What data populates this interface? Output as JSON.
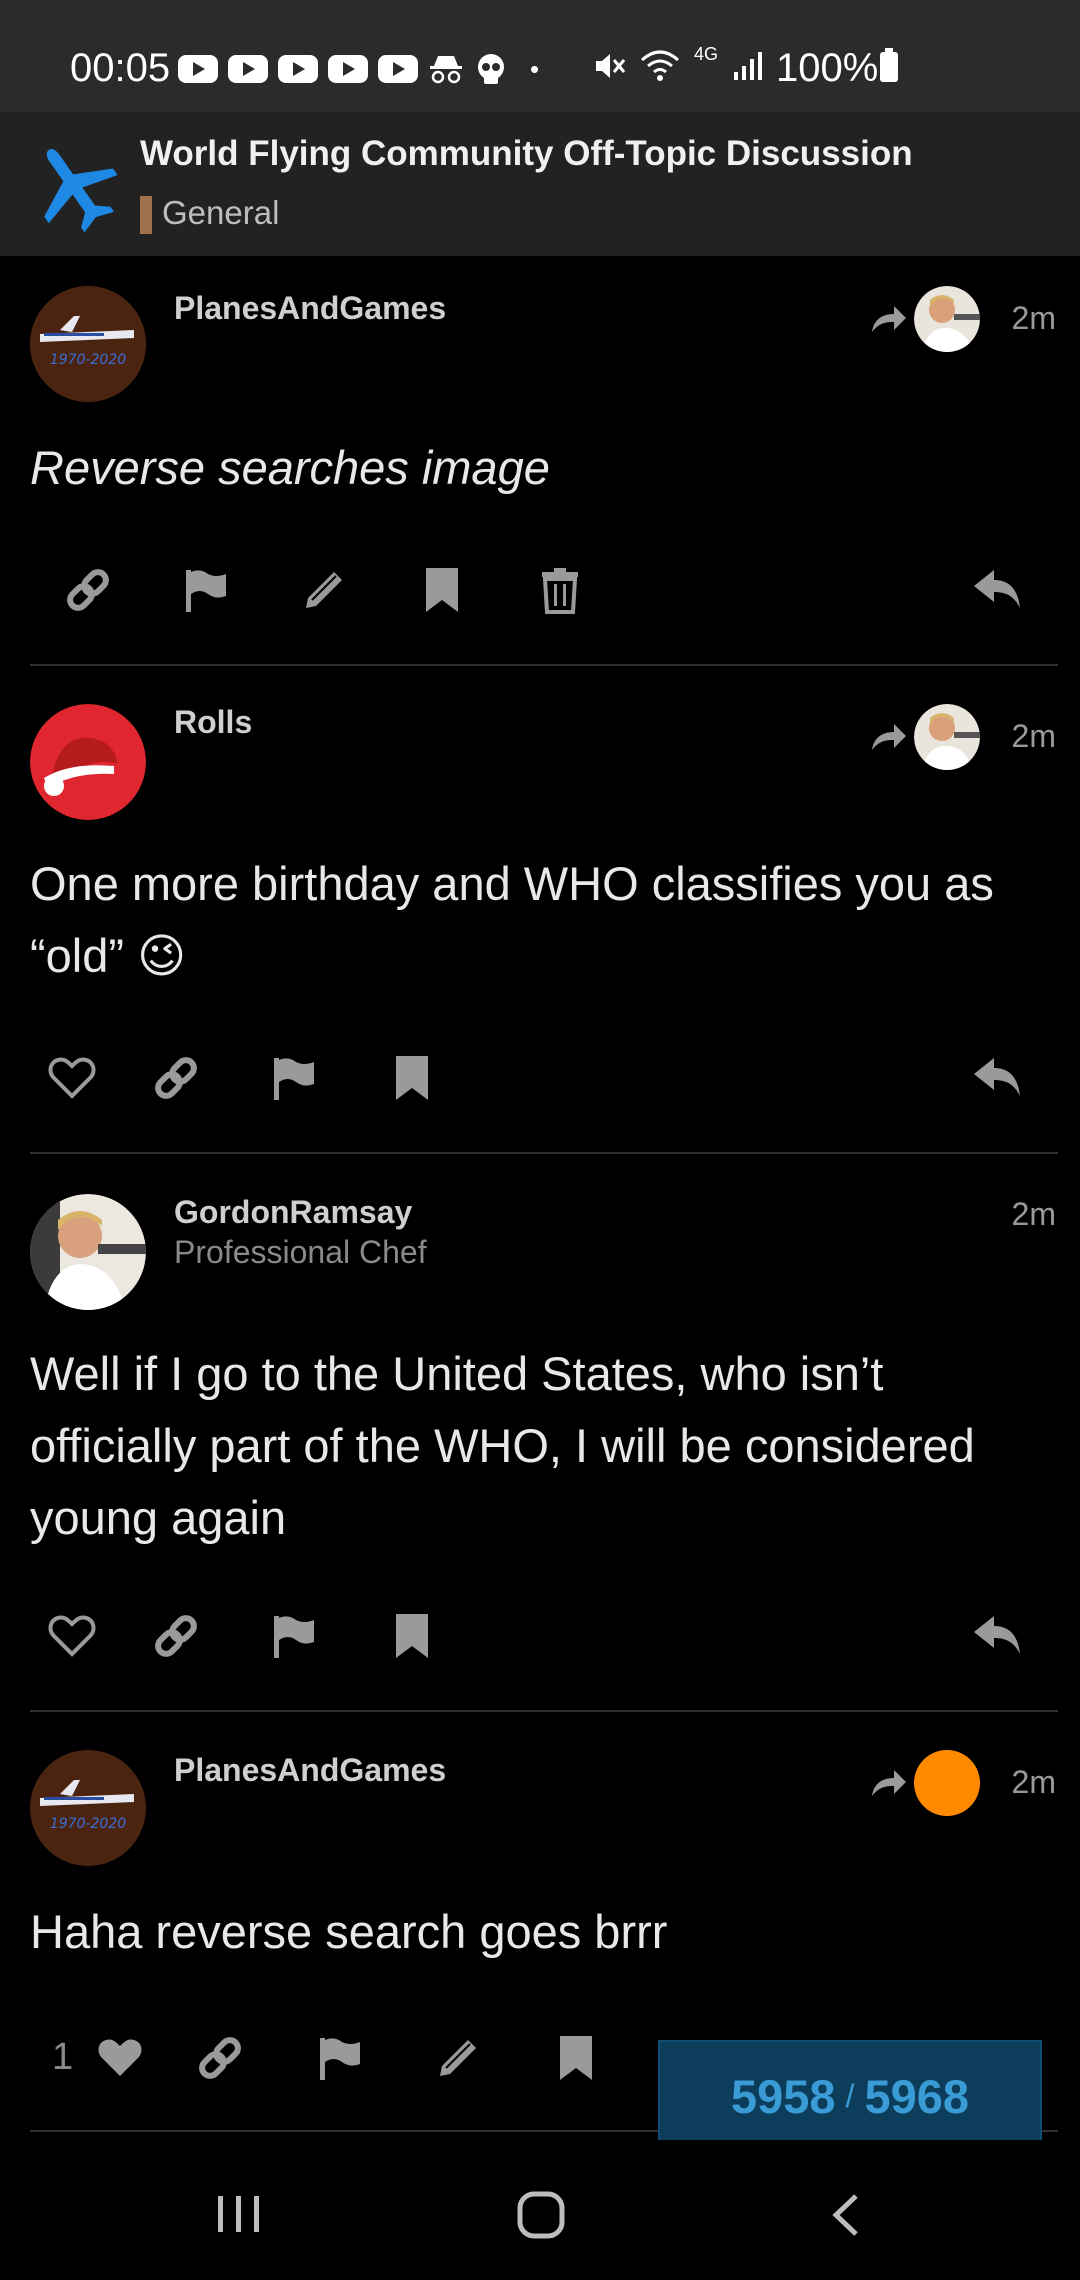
{
  "status_bar": {
    "time": "00:05",
    "network": "4G",
    "battery": "100%",
    "icons": [
      "youtube-icon",
      "youtube-icon",
      "youtube-icon",
      "youtube-icon",
      "youtube-icon",
      "incognito-icon",
      "skull-icon",
      "dot-icon",
      "mute-icon",
      "wifi-icon",
      "signal-icon",
      "battery-icon"
    ]
  },
  "topic": {
    "title": "World Flying Community Off-Topic Discussion",
    "category": "General",
    "category_color": "#a0714a",
    "icon": "airplane-icon",
    "icon_color": "#1e88e5"
  },
  "posts": [
    {
      "username": "PlanesAndGames",
      "user_title": "",
      "time": "2m",
      "body": "Reverse searches image",
      "italic": true,
      "reply_to": true,
      "actions": [
        "link-icon",
        "flag-icon",
        "edit-icon",
        "bookmark-icon",
        "delete-icon",
        "reply-icon"
      ]
    },
    {
      "username": "Rolls",
      "user_title": "",
      "time": "2m",
      "body": "One more birthday and WHO classifies you as “old” 😉",
      "reply_to": true,
      "actions": [
        "like-icon",
        "link-icon",
        "flag-icon",
        "bookmark-icon",
        "reply-icon"
      ]
    },
    {
      "username": "GordonRamsay",
      "user_title": "Professional Chef",
      "time": "2m",
      "body": "Well if I go to the United States, who isn’t officially part of the WHO, I will be considered young again",
      "reply_to": false,
      "actions": [
        "like-icon",
        "link-icon",
        "flag-icon",
        "bookmark-icon",
        "reply-icon"
      ]
    },
    {
      "username": "PlanesAndGames",
      "user_title": "",
      "time": "2m",
      "body": "Haha reverse search goes brrr",
      "reply_to": true,
      "like_count": "1",
      "actions": [
        "like-icon",
        "link-icon",
        "flag-icon",
        "edit-icon",
        "bookmark-icon"
      ]
    }
  ],
  "progress": {
    "current": "5958",
    "separator": "/",
    "total": "5968"
  },
  "nav": [
    "recents-icon",
    "home-icon",
    "back-icon"
  ]
}
